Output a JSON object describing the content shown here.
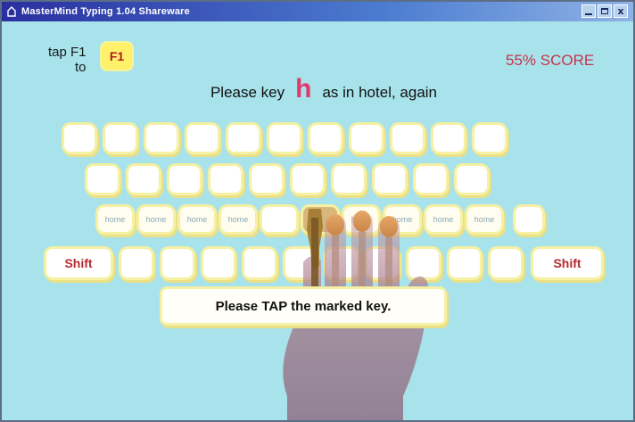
{
  "window": {
    "title": "MasterMind Typing 1.04 Shareware",
    "controls": {
      "minimize": "_",
      "maximize": "□",
      "close": "x"
    }
  },
  "hint": {
    "tap_label": "tap F1\nto",
    "key_label": "F1"
  },
  "score": {
    "text": "55% SCORE"
  },
  "prompt": {
    "before": "Please key",
    "target": "h",
    "after": "as in hotel, again"
  },
  "keyboard": {
    "home_label": "home",
    "shift_label": "Shift",
    "target_key_color": "#b8863a"
  },
  "message": {
    "text": "Please TAP the marked key."
  },
  "colors": {
    "background": "#a8e2ea",
    "key_glow": "#f6f0a2",
    "score": "#c7334a",
    "target_letter": "#e3386a",
    "shift_text": "#b42a30",
    "hand": "#9a6f80"
  }
}
